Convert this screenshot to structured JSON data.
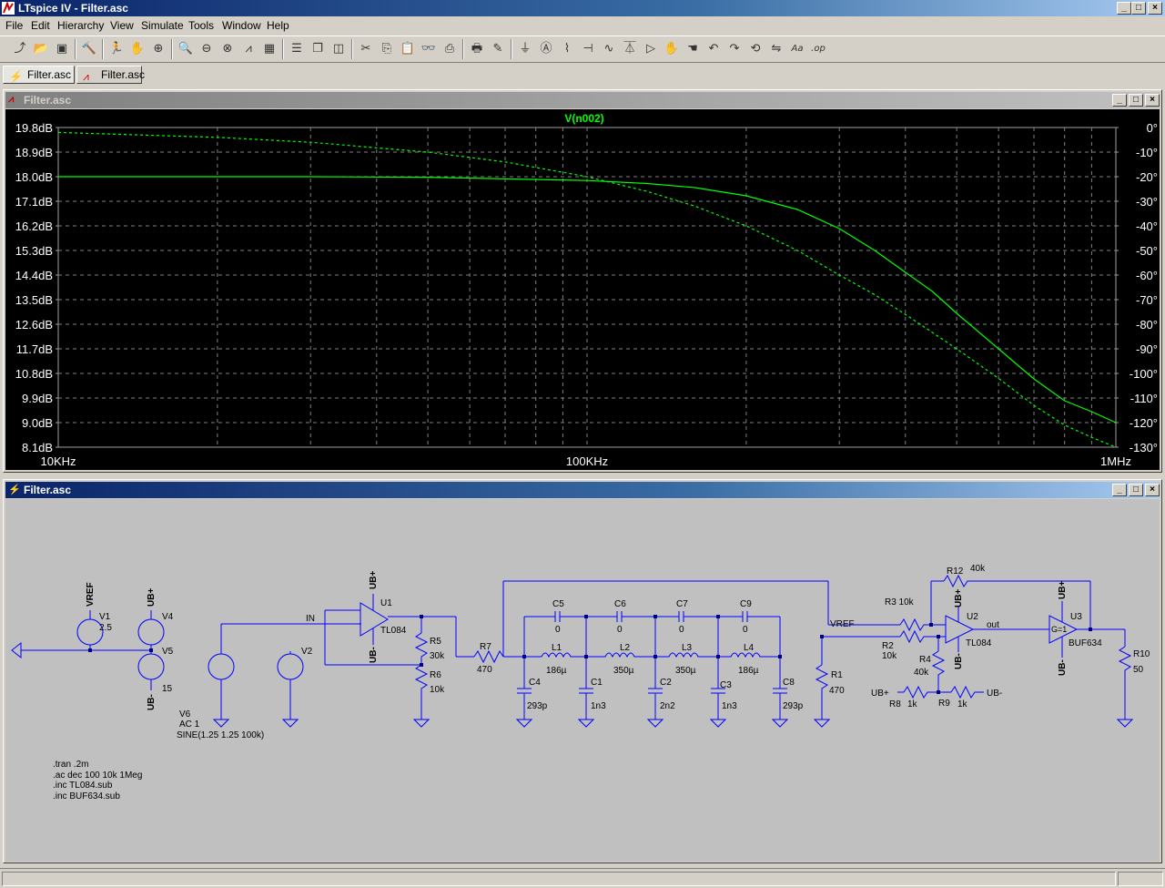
{
  "app": {
    "title": "LTspice IV - Filter.asc"
  },
  "window_controls": {
    "minimize": "_",
    "maximize": "□",
    "close": "×"
  },
  "menu": [
    "File",
    "Edit",
    "Hierarchy",
    "View",
    "Simulate",
    "Tools",
    "Window",
    "Help"
  ],
  "toolbar_icons": [
    "new-schematic-icon",
    "open-icon",
    "save-icon",
    "control-panel-icon",
    "run-icon",
    "halt-icon",
    "zoom-in-icon",
    "zoom-pan-icon",
    "zoom-out-icon",
    "zoom-cancel-icon",
    "autorange-icon",
    "waveform-grid-icon",
    "tile-horizontal-icon",
    "cascade-icon",
    "tile-vertical-icon",
    "cut-icon",
    "copy-icon",
    "paste-icon",
    "find-icon",
    "print-setup-icon",
    "print-icon",
    "draw-wire-icon",
    "ground-icon",
    "label-net-icon",
    "resistor-icon",
    "capacitor-icon",
    "inductor-icon",
    "diode-icon",
    "component-icon",
    "move-icon",
    "drag-icon",
    "undo-icon",
    "redo-icon",
    "rotate-icon",
    "mirror-icon",
    "text-icon",
    "spice-directive-icon"
  ],
  "tabs": [
    {
      "label": "Filter.asc",
      "icon": "schematic-icon"
    },
    {
      "label": "Filter.asc",
      "icon": "waveform-icon"
    }
  ],
  "plot_window": {
    "title": "Filter.asc"
  },
  "schematic_window": {
    "title": "Filter.asc"
  },
  "chart_data": {
    "type": "line",
    "title": "V(n002)",
    "x_scale": "log",
    "xlim": [
      10000,
      1000000
    ],
    "x_tick_labels": [
      {
        "value": 10000,
        "label": "10KHz"
      },
      {
        "value": 100000,
        "label": "100KHz"
      },
      {
        "value": 1000000,
        "label": "1MHz"
      }
    ],
    "y_left_lim": [
      8.1,
      19.8
    ],
    "y_left_ticks": [
      "19.8dB",
      "18.9dB",
      "18.0dB",
      "17.1dB",
      "16.2dB",
      "15.3dB",
      "14.4dB",
      "13.5dB",
      "12.6dB",
      "11.7dB",
      "10.8dB",
      "9.9dB",
      "9.0dB",
      "8.1dB"
    ],
    "y_right_lim": [
      -130,
      0
    ],
    "y_right_ticks": [
      "0°",
      "-10°",
      "-20°",
      "-30°",
      "-40°",
      "-50°",
      "-60°",
      "-70°",
      "-80°",
      "-90°",
      "-100°",
      "-110°",
      "-120°",
      "-130°"
    ],
    "grid": true,
    "series": [
      {
        "name": "V(n002)",
        "quantity": "magnitude",
        "axis": "left",
        "style": "solid",
        "color": "#00ff00",
        "x": [
          10000,
          20000,
          30000,
          50000,
          70000,
          100000,
          130000,
          160000,
          200000,
          250000,
          300000,
          350000,
          400000,
          450000,
          500000,
          600000,
          700000,
          800000,
          900000,
          1000000
        ],
        "y": [
          18.0,
          18.0,
          18.0,
          17.98,
          17.92,
          17.86,
          17.75,
          17.6,
          17.3,
          16.8,
          16.1,
          15.3,
          14.5,
          13.8,
          13.0,
          11.7,
          10.6,
          9.8,
          9.4,
          9.0
        ]
      },
      {
        "name": "V(n002)",
        "quantity": "phase",
        "axis": "right",
        "style": "dashed",
        "color": "#00ff00",
        "x": [
          10000,
          20000,
          30000,
          50000,
          70000,
          100000,
          130000,
          160000,
          200000,
          250000,
          300000,
          350000,
          400000,
          500000,
          600000,
          700000,
          800000,
          900000,
          1000000
        ],
        "y": [
          -2,
          -4,
          -6,
          -10,
          -14,
          -20,
          -26,
          -32,
          -40,
          -50,
          -60,
          -68,
          -76,
          -90,
          -102,
          -113,
          -121,
          -126,
          -130
        ]
      }
    ]
  },
  "schematic": {
    "labels": {
      "V1": "V1",
      "V1_val": "2.5",
      "V4": "V4",
      "V5": "V5",
      "V5_val": "15",
      "V2": "V2",
      "V6": "V6",
      "V6_ac": "AC 1",
      "V6_sine": "SINE(1.25 1.25 100k)",
      "VREF": "VREF",
      "UBp": "UB+",
      "UBm": "UB-",
      "IN": "IN",
      "U1": "U1",
      "TL084": "TL084",
      "R5": "R5",
      "R5_val": "30k",
      "R6": "R6",
      "R6_val": "10k",
      "R7": "R7",
      "R7_val": "470",
      "C5": "C5",
      "C6": "C6",
      "C7": "C7",
      "C9": "C9",
      "zero": "0",
      "L1": "L1",
      "L1_val": "186µ",
      "L2": "L2",
      "L2_val": "350µ",
      "L3": "L3",
      "L3_val": "350µ",
      "L4": "L4",
      "L4_val": "186µ",
      "C4": "C4",
      "C4_val": "293p",
      "C1": "C1",
      "C1_val": "1n3",
      "C2": "C2",
      "C2_val": "2n2",
      "C3": "C3",
      "C3_val": "1n3",
      "C8": "C8",
      "C8_val": "293p",
      "R1": "R1",
      "R1_val": "470",
      "VREF2": "VREF",
      "R3": "R3 10k",
      "R2": "R2",
      "R2_val": "10k",
      "R4": "R4",
      "R4_val": "40k",
      "R12": "R12",
      "R12_val": "40k",
      "U2": "U2",
      "U2_type": "TL084",
      "out": "out",
      "U3": "U3",
      "U3_type": "BUF634",
      "G1": "G=1",
      "R10": "R10",
      "R10_val": "50",
      "R8": "R8",
      "R8_val": "1k",
      "R9": "R9",
      "R9_val": "1k",
      "UBp2": "UB+",
      "UBm2": "UB-"
    },
    "directives": [
      ".tran .2m",
      ".ac dec 100 10k 1Meg",
      ".inc TL084.sub",
      ".inc BUF634.sub"
    ]
  }
}
